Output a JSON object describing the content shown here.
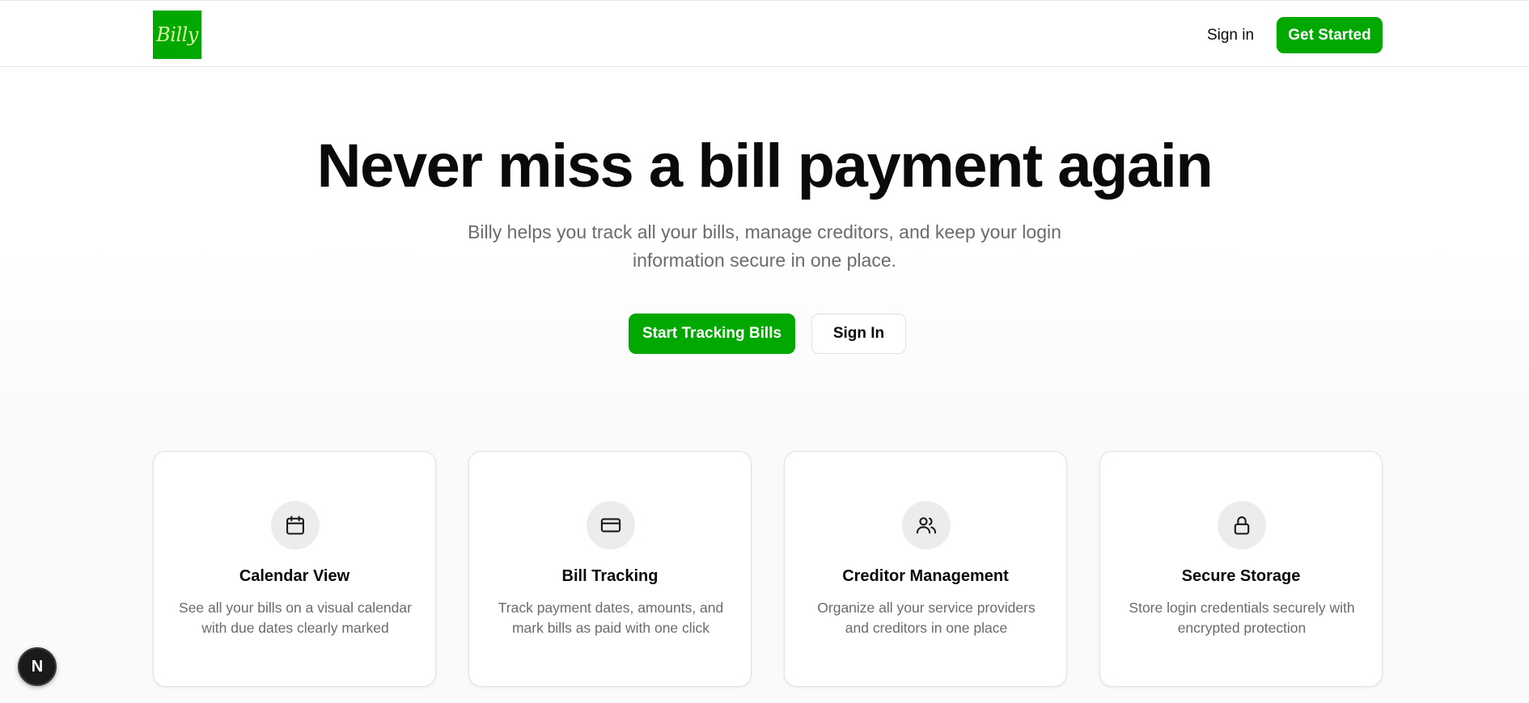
{
  "header": {
    "logo_text": "Billy",
    "signin_label": "Sign in",
    "get_started_label": "Get Started"
  },
  "hero": {
    "title": "Never miss a bill payment again",
    "subtitle": "Billy helps you track all your bills, manage creditors, and keep your login information secure in one place.",
    "primary_cta": "Start Tracking Bills",
    "secondary_cta": "Sign In"
  },
  "features": [
    {
      "icon": "calendar-icon",
      "title": "Calendar View",
      "description": "See all your bills on a visual calendar with due dates clearly marked"
    },
    {
      "icon": "credit-card-icon",
      "title": "Bill Tracking",
      "description": "Track payment dates, amounts, and mark bills as paid with one click"
    },
    {
      "icon": "users-icon",
      "title": "Creditor Management",
      "description": "Organize all your service providers and creditors in one place"
    },
    {
      "icon": "lock-icon",
      "title": "Secure Storage",
      "description": "Store login credentials securely with encrypted protection"
    }
  ],
  "badge": {
    "letter": "N"
  },
  "colors": {
    "brand_green": "#00a800",
    "text_dark": "#0a0a0a",
    "text_muted": "#6b6b6b",
    "icon_bg": "#ececec"
  }
}
